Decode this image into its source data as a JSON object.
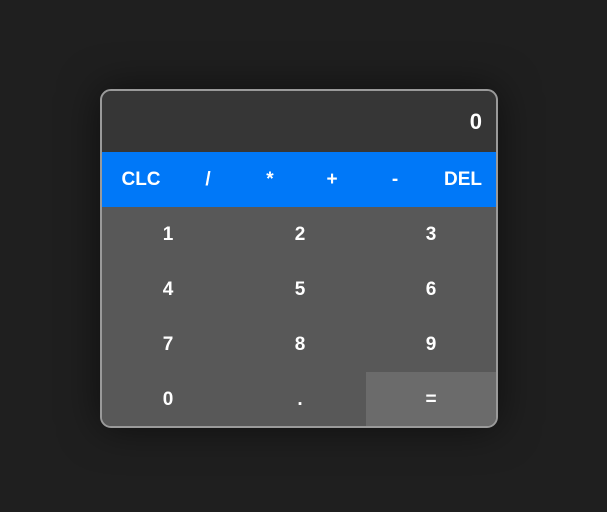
{
  "display": {
    "value": "0"
  },
  "operators": {
    "clear": "CLC",
    "divide": "/",
    "multiply": "*",
    "add": "+",
    "subtract": "-",
    "delete": "DEL"
  },
  "keys": {
    "k1": "1",
    "k2": "2",
    "k3": "3",
    "k4": "4",
    "k5": "5",
    "k6": "6",
    "k7": "7",
    "k8": "8",
    "k9": "9",
    "k0": "0",
    "decimal": ".",
    "equals": "="
  },
  "colors": {
    "page_background": "#1f1f1f",
    "display_background": "#363636",
    "operator_bar": "#0078f8",
    "keypad_background": "#585858",
    "equals_background": "#6b6b6b",
    "text": "#ffffff"
  }
}
